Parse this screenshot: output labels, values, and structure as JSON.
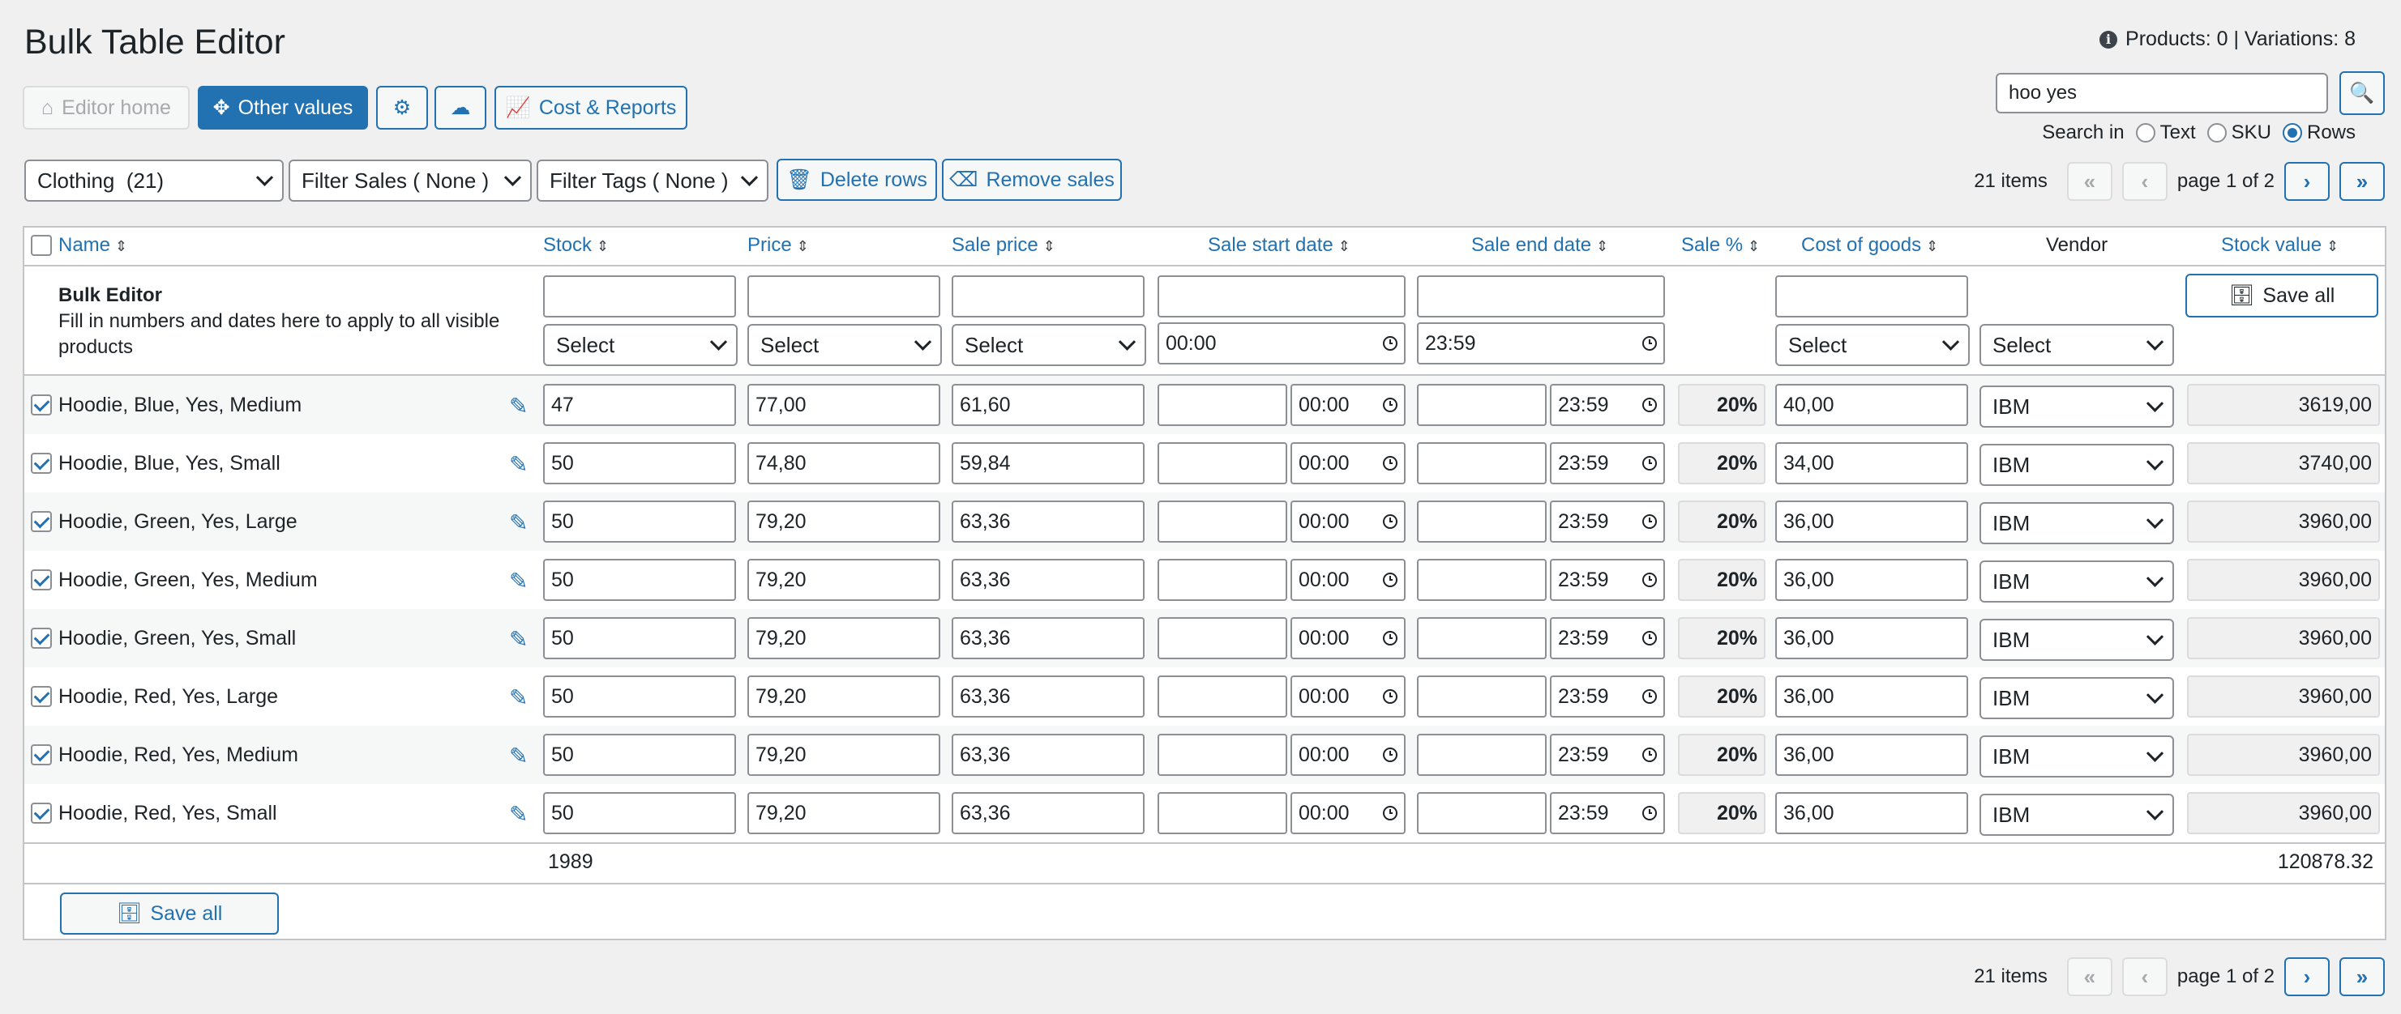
{
  "title": "Bulk Table Editor",
  "stats": "Products: 0 | Variations: 8",
  "toolbar": {
    "editor_home": "Editor home",
    "other_values": "Other values",
    "cost_reports": "Cost & Reports"
  },
  "search": {
    "value": "hoo yes",
    "search_in_label": "Search in",
    "options": [
      "Text",
      "SKU",
      "Rows"
    ],
    "selected": "Rows"
  },
  "filters": {
    "category": "Clothing  (21)",
    "sales": "Filter Sales ( None )",
    "tags": "Filter Tags ( None )",
    "delete_rows": "Delete rows",
    "remove_sales": "Remove sales"
  },
  "pagination": {
    "items": "21 items",
    "page": "page 1 of 2"
  },
  "columns": {
    "name": "Name",
    "stock": "Stock",
    "price": "Price",
    "sale_price": "Sale price",
    "sale_start": "Sale start date",
    "sale_end": "Sale end date",
    "sale_pct": "Sale %",
    "cost": "Cost of goods",
    "vendor": "Vendor",
    "stock_value": "Stock value"
  },
  "bulk": {
    "title": "Bulk Editor",
    "description": "Fill in numbers and dates here to apply to all visible products",
    "select": "Select",
    "start_time": "00:00",
    "end_time": "23:59",
    "save_all": "Save all"
  },
  "rows": [
    {
      "name": "Hoodie, Blue, Yes, Medium",
      "stock": "47",
      "price": "77,00",
      "sale_price": "61,60",
      "start_time": "00:00",
      "end_time": "23:59",
      "sale_pct": "20%",
      "cost": "40,00",
      "vendor": "IBM",
      "stock_value": "3619,00"
    },
    {
      "name": "Hoodie, Blue, Yes, Small",
      "stock": "50",
      "price": "74,80",
      "sale_price": "59,84",
      "start_time": "00:00",
      "end_time": "23:59",
      "sale_pct": "20%",
      "cost": "34,00",
      "vendor": "IBM",
      "stock_value": "3740,00"
    },
    {
      "name": "Hoodie, Green, Yes, Large",
      "stock": "50",
      "price": "79,20",
      "sale_price": "63,36",
      "start_time": "00:00",
      "end_time": "23:59",
      "sale_pct": "20%",
      "cost": "36,00",
      "vendor": "IBM",
      "stock_value": "3960,00"
    },
    {
      "name": "Hoodie, Green, Yes, Medium",
      "stock": "50",
      "price": "79,20",
      "sale_price": "63,36",
      "start_time": "00:00",
      "end_time": "23:59",
      "sale_pct": "20%",
      "cost": "36,00",
      "vendor": "IBM",
      "stock_value": "3960,00"
    },
    {
      "name": "Hoodie, Green, Yes, Small",
      "stock": "50",
      "price": "79,20",
      "sale_price": "63,36",
      "start_time": "00:00",
      "end_time": "23:59",
      "sale_pct": "20%",
      "cost": "36,00",
      "vendor": "IBM",
      "stock_value": "3960,00"
    },
    {
      "name": "Hoodie, Red, Yes, Large",
      "stock": "50",
      "price": "79,20",
      "sale_price": "63,36",
      "start_time": "00:00",
      "end_time": "23:59",
      "sale_pct": "20%",
      "cost": "36,00",
      "vendor": "IBM",
      "stock_value": "3960,00"
    },
    {
      "name": "Hoodie, Red, Yes, Medium",
      "stock": "50",
      "price": "79,20",
      "sale_price": "63,36",
      "start_time": "00:00",
      "end_time": "23:59",
      "sale_pct": "20%",
      "cost": "36,00",
      "vendor": "IBM",
      "stock_value": "3960,00"
    },
    {
      "name": "Hoodie, Red, Yes, Small",
      "stock": "50",
      "price": "79,20",
      "sale_price": "63,36",
      "start_time": "00:00",
      "end_time": "23:59",
      "sale_pct": "20%",
      "cost": "36,00",
      "vendor": "IBM",
      "stock_value": "3960,00"
    }
  ],
  "totals": {
    "stock": "1989",
    "stock_value": "120878.32"
  },
  "footer": {
    "save_all": "Save all"
  },
  "icons": {
    "home": "home-icon",
    "move": "move-icon",
    "gear": "gear-icon",
    "cloud": "cloud-download-icon",
    "chart": "line-chart-icon",
    "trash": "trash-icon",
    "eraser": "eraser-icon",
    "search": "search-icon",
    "database": "database-icon",
    "edit": "edit-icon",
    "info": "info-icon"
  },
  "colors": {
    "accent": "#2271b1",
    "text": "#1d2327",
    "background": "#f0f0f1",
    "border": "#8c8f94"
  }
}
